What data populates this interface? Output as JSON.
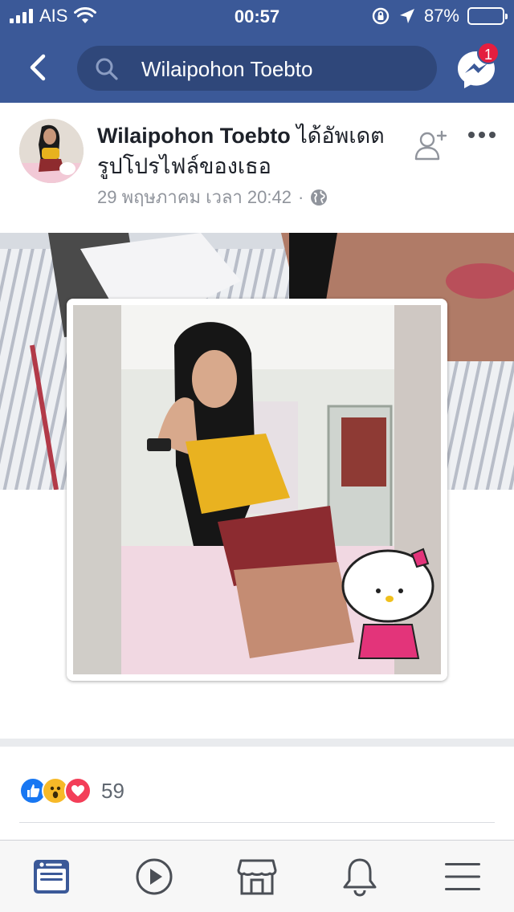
{
  "status_bar": {
    "carrier": "AIS",
    "time": "00:57",
    "battery": "87%",
    "battery_level": 0.87
  },
  "nav": {
    "search_query": "Wilaipohon Toebto",
    "messenger_badge": "1"
  },
  "post": {
    "author": "Wilaipohon Toebto",
    "action_text": " ได้อัพเดตรูปโปรไฟล์ของเธอ",
    "timestamp": "29 พฤษภาคม เวลา 20:42",
    "separator": "·",
    "privacy_icon": "globe-icon"
  },
  "reactions": {
    "types": [
      "like",
      "wow",
      "love"
    ],
    "count": "59"
  },
  "tabs": [
    {
      "name": "news-feed",
      "icon": "news-feed-icon",
      "active": true
    },
    {
      "name": "watch",
      "icon": "play-icon",
      "active": false
    },
    {
      "name": "marketplace",
      "icon": "marketplace-icon",
      "active": false
    },
    {
      "name": "notifications",
      "icon": "bell-icon",
      "active": false
    },
    {
      "name": "menu",
      "icon": "menu-icon",
      "active": false
    }
  ],
  "colors": {
    "brand": "#3b5998",
    "brand_dark": "#2f477a",
    "like": "#1877f2",
    "love": "#f33e58",
    "wow": "#f7b928",
    "badge": "#e41e3f"
  }
}
